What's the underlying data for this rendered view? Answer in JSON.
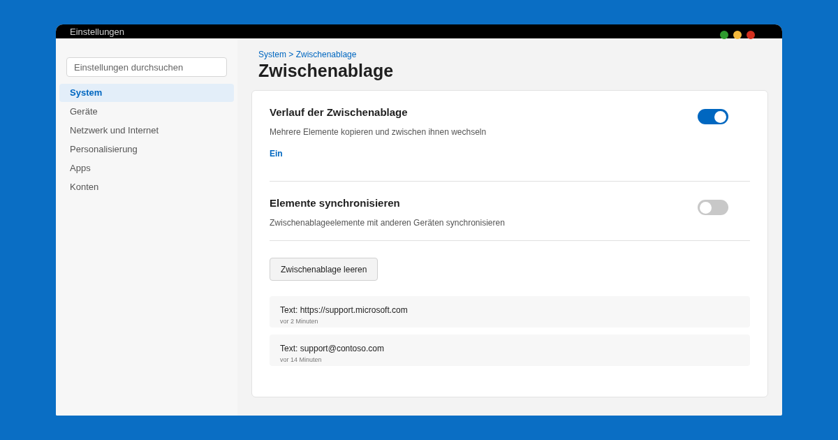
{
  "window": {
    "title": "Einstellungen"
  },
  "window_controls": [
    {
      "color": "#2e9a2e"
    },
    {
      "color": "#f4b83c"
    },
    {
      "color": "#d3301f"
    }
  ],
  "sidebar": {
    "search": {
      "placeholder": "Einstellungen durchsuchen"
    },
    "items": [
      {
        "label": "System",
        "selected": true
      },
      {
        "label": "Geräte",
        "selected": false
      },
      {
        "label": "Netzwerk und Internet",
        "selected": false
      },
      {
        "label": "Personalisierung",
        "selected": false
      },
      {
        "label": "Apps",
        "selected": false
      },
      {
        "label": "Konten",
        "selected": false
      }
    ]
  },
  "breadcrumb": "System > Zwischenablage",
  "page_title": "Zwischenablage",
  "settings": [
    {
      "title": "Verlauf der Zwischenablage",
      "description": "Mehrere Elemente kopieren und zwischen ihnen wechseln",
      "on": true,
      "status": "Ein"
    },
    {
      "title": "Elemente synchronisieren",
      "description": "Zwischenablageelemente mit anderen Geräten synchronisieren",
      "on": false
    }
  ],
  "clear_button": "Zwischenablage leeren",
  "history": [
    {
      "text": "Text: https://support.microsoft.com",
      "time": "vor 2 Minuten"
    },
    {
      "text": "Text: support@contoso.com",
      "time": "vor 14 Minuten"
    }
  ]
}
